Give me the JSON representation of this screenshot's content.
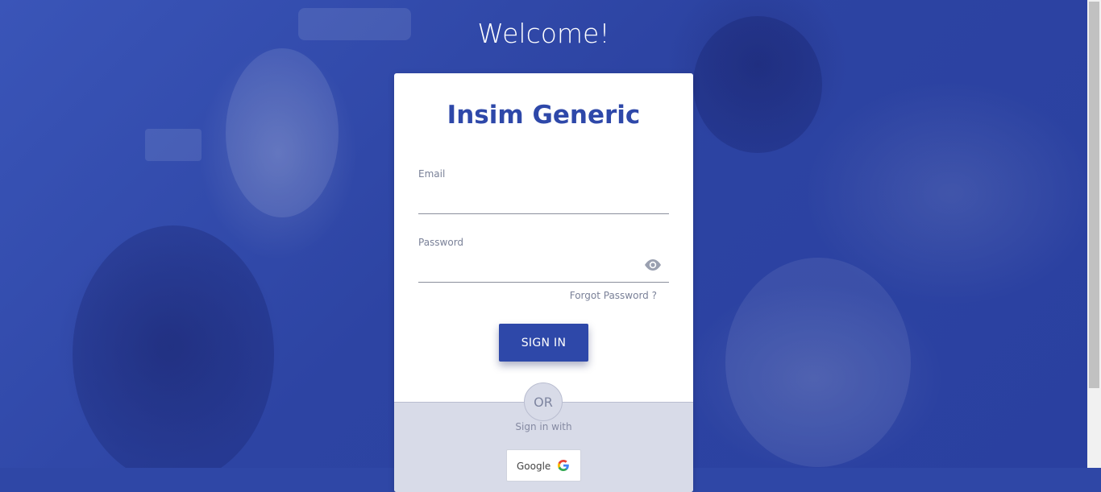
{
  "page": {
    "welcome_title": "Welcome!"
  },
  "login_card": {
    "brand": "Insim Generic",
    "email": {
      "label": "Email",
      "value": "",
      "placeholder": ""
    },
    "password": {
      "label": "Password",
      "value": "",
      "placeholder": "",
      "toggle_icon": "eye-icon"
    },
    "forgot_password": "Forgot Password ?",
    "signin_button": "SIGN IN",
    "divider_text": "OR",
    "sign_in_with": "Sign in with",
    "providers": [
      {
        "label": "Google",
        "icon": "google-icon"
      }
    ]
  },
  "colors": {
    "primary": "#2e48a9",
    "background_overlay": "#2f47a6",
    "lower_panel": "#d8dbe8",
    "muted_text": "#7a8198"
  }
}
